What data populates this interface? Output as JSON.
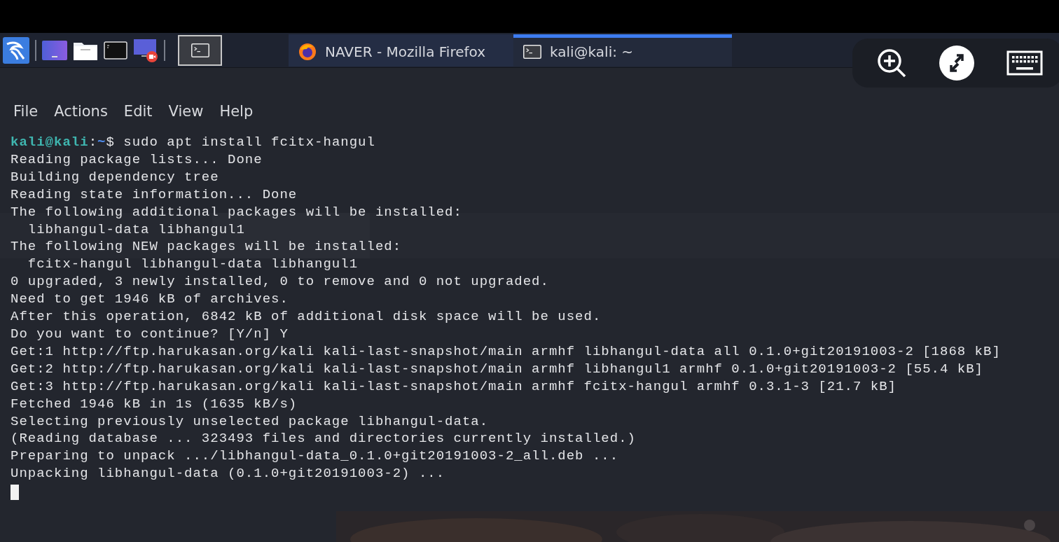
{
  "taskbar": {
    "launchers": [
      {
        "kind": "logo"
      },
      {
        "kind": "desktop"
      },
      {
        "kind": "folder"
      },
      {
        "kind": "terminal"
      },
      {
        "kind": "recorder"
      },
      {
        "kind": "divider"
      },
      {
        "kind": "active-terminal"
      }
    ],
    "tasks": [
      {
        "kind": "browser",
        "title": "NAVER - Mozilla Firefox",
        "selected": false
      },
      {
        "kind": "terminal",
        "title": "kali@kali: ~",
        "selected": true
      }
    ]
  },
  "remote_toolbar": {
    "buttons": [
      {
        "kind": "zoom"
      },
      {
        "kind": "remote"
      },
      {
        "kind": "keyboard"
      }
    ]
  },
  "terminal": {
    "menu": [
      "File",
      "Actions",
      "Edit",
      "View",
      "Help"
    ],
    "prompt": {
      "user": "kali@kali",
      "sep": ":",
      "path": "~",
      "symbol": "$",
      "command": " sudo apt install fcitx-hangul"
    },
    "lines": [
      "Reading package lists... Done",
      "Building dependency tree",
      "Reading state information... Done",
      "The following additional packages will be installed:",
      "  libhangul-data libhangul1",
      "The following NEW packages will be installed:",
      "  fcitx-hangul libhangul-data libhangul1",
      "0 upgraded, 3 newly installed, 0 to remove and 0 not upgraded.",
      "Need to get 1946 kB of archives.",
      "After this operation, 6842 kB of additional disk space will be used.",
      "Do you want to continue? [Y/n] Y",
      "Get:1 http://ftp.harukasan.org/kali kali-last-snapshot/main armhf libhangul-data all 0.1.0+git20191003-2 [1868 kB]",
      "Get:2 http://ftp.harukasan.org/kali kali-last-snapshot/main armhf libhangul1 armhf 0.1.0+git20191003-2 [55.4 kB]",
      "Get:3 http://ftp.harukasan.org/kali kali-last-snapshot/main armhf fcitx-hangul armhf 0.3.1-3 [21.7 kB]",
      "Fetched 1946 kB in 1s (1635 kB/s)",
      "Selecting previously unselected package libhangul-data.",
      "(Reading database ... 323493 files and directories currently installed.)",
      "Preparing to unpack .../libhangul-data_0.1.0+git20191003-2_all.deb ...",
      "Unpacking libhangul-data (0.1.0+git20191003-2) ..."
    ],
    "cursor": true
  }
}
